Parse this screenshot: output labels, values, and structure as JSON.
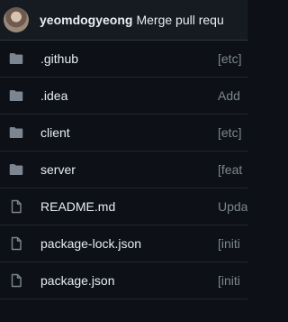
{
  "header": {
    "author": "yeomdogyeong",
    "commit_message": "Merge pull requ"
  },
  "files": [
    {
      "name": ".github",
      "type": "folder",
      "icon": "folder-icon",
      "commit": "[etc]"
    },
    {
      "name": ".idea",
      "type": "folder",
      "icon": "folder-icon",
      "commit": "Add"
    },
    {
      "name": "client",
      "type": "folder",
      "icon": "folder-icon",
      "commit": "[etc]"
    },
    {
      "name": "server",
      "type": "folder",
      "icon": "folder-icon",
      "commit": "[feat"
    },
    {
      "name": "README.md",
      "type": "file",
      "icon": "file-icon",
      "commit": "Upda"
    },
    {
      "name": "package-lock.json",
      "type": "file",
      "icon": "file-icon",
      "commit": "[initi"
    },
    {
      "name": "package.json",
      "type": "file",
      "icon": "file-icon",
      "commit": "[initi"
    }
  ],
  "colors": {
    "background": "#0d1117",
    "header_background": "#161b22",
    "icon": "#7d8590",
    "muted_text": "#7d8590"
  }
}
